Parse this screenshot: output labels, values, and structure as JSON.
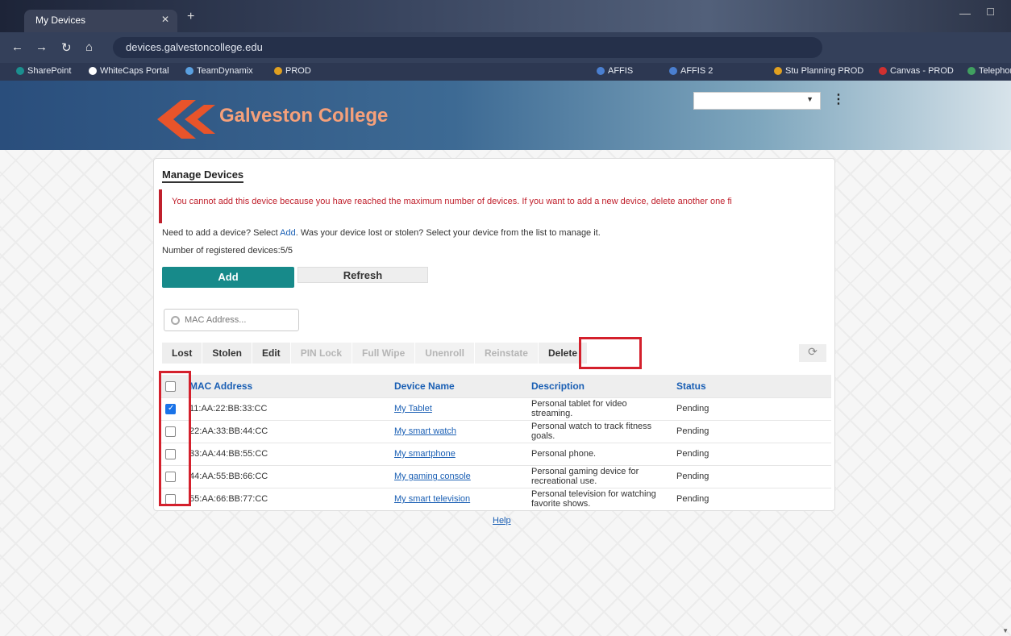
{
  "browser": {
    "tab_title": "My Devices",
    "url": "devices.galvestoncollege.edu",
    "bookmarks": [
      {
        "label": "SharePoint",
        "color": "#1b8f8f"
      },
      {
        "label": "WhiteCaps Portal",
        "color": "#ffffff"
      },
      {
        "label": "TeamDynamix",
        "color": "#5aa0e0"
      },
      {
        "label": "PROD",
        "color": "#e0a020"
      },
      {
        "label": "AFFIS",
        "color": "#4a7fd0"
      },
      {
        "label": "AFFIS 2",
        "color": "#4a7fd0"
      },
      {
        "label": "Stu Planning PROD",
        "color": "#e0a020"
      },
      {
        "label": "Canvas - PROD",
        "color": "#d03030"
      },
      {
        "label": "Telephone",
        "color": "#40a060"
      }
    ]
  },
  "header": {
    "brand": "Galveston College"
  },
  "panel": {
    "title": "Manage Devices",
    "error": "You cannot add this device because you have reached the maximum number of devices. If you want to add a new device, delete another one fi",
    "info_prefix": "Need to add a device? Select",
    "info_link": "Add",
    "info_suffix": ". Was your device lost or stolen? Select your device from the list to manage it.",
    "device_count": "Number of registered devices:5/5",
    "add_label": "Add",
    "refresh_label": "Refresh",
    "search_placeholder": "MAC Address...",
    "actions": {
      "lost": "Lost",
      "stolen": "Stolen",
      "edit": "Edit",
      "pin_lock": "PIN Lock",
      "full_wipe": "Full Wipe",
      "unenroll": "Unenroll",
      "reinstate": "Reinstate",
      "delete": "Delete"
    },
    "columns": {
      "mac": "MAC Address",
      "name": "Device Name",
      "description": "Description",
      "status": "Status"
    },
    "rows": [
      {
        "mac": "11:AA:22:BB:33:CC",
        "name": "My Tablet",
        "description": "Personal tablet for video streaming.",
        "status": "Pending",
        "checked": true
      },
      {
        "mac": "22:AA:33:BB:44:CC",
        "name": "My smart watch",
        "description": "Personal watch to track fitness goals.",
        "status": "Pending",
        "checked": false
      },
      {
        "mac": "33:AA:44:BB:55:CC",
        "name": "My smartphone",
        "description": "Personal phone.",
        "status": "Pending",
        "checked": false
      },
      {
        "mac": "44:AA:55:BB:66:CC",
        "name": "My gaming console",
        "description": "Personal gaming device for recreational use.",
        "status": "Pending",
        "checked": false
      },
      {
        "mac": "55:AA:66:BB:77:CC",
        "name": "My smart television",
        "description": "Personal television for watching favorite shows.",
        "status": "Pending",
        "checked": false
      }
    ],
    "help": "Help"
  }
}
